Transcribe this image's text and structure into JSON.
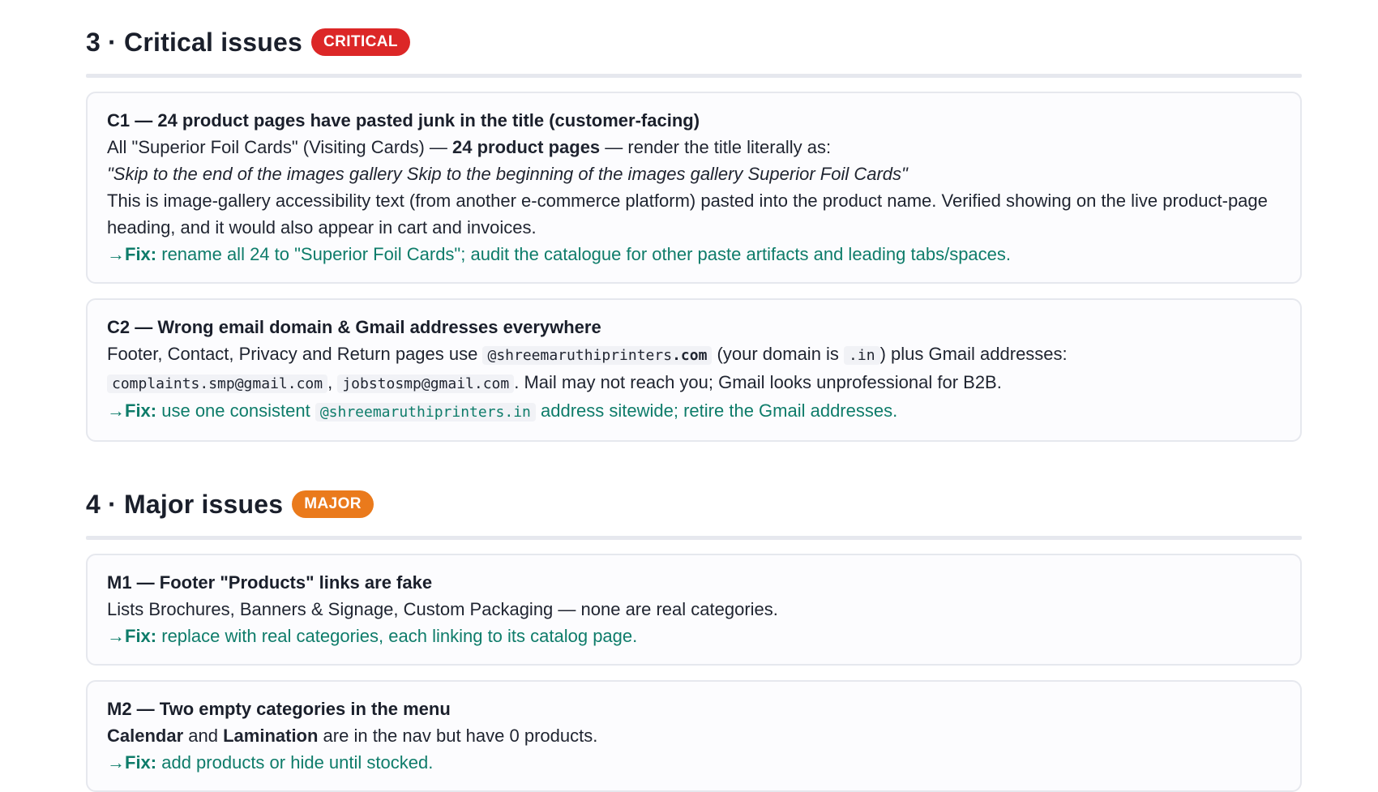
{
  "critical": {
    "heading": "3 · Critical issues",
    "badge": "CRITICAL",
    "c1": {
      "title": "C1 — 24 product pages have pasted junk in the title (customer-facing)",
      "p1_a": "All \"Superior Foil Cards\" (Visiting Cards) — ",
      "p1_b": "24 product pages",
      "p1_c": " — render the title literally as:",
      "quote": "\"Skip to the end of the images gallery Skip to the beginning of the images gallery Superior Foil Cards\"",
      "p2": "This is image-gallery accessibility text (from another e-commerce platform) pasted into the product name. Verified showing on the live product-page heading, and it would also appear in cart and invoices.",
      "fix_arrow": "→",
      "fix_label": "Fix:",
      "fix_text": " rename all 24 to \"Superior Foil Cards\"; audit the catalogue for other paste artifacts and leading tabs/spaces."
    },
    "c2": {
      "title": "C2 — Wrong email domain & Gmail addresses everywhere",
      "p1_a": "Footer, Contact, Privacy and Return pages use ",
      "code_domain_a": "@shreemaruthiprinters",
      "code_domain_b": ".com",
      "p1_b": " (your domain is ",
      "code_in": ".in",
      "p1_c": ") plus Gmail addresses:",
      "code_gmail1": "complaints.smp@gmail.com",
      "comma": ", ",
      "code_gmail2": "jobstosmp@gmail.com",
      "p1_d": ". Mail may not reach you; Gmail looks unprofessional for B2B.",
      "fix_arrow": "→",
      "fix_label": "Fix:",
      "fix_a": " use one consistent ",
      "fix_code": "@shreemaruthiprinters.in",
      "fix_b": " address sitewide; retire the Gmail addresses."
    }
  },
  "major": {
    "heading": "4 · Major issues",
    "badge": "MAJOR",
    "m1": {
      "title": "M1 — Footer \"Products\" links are fake",
      "p1": "Lists Brochures, Banners & Signage, Custom Packaging — none are real categories.",
      "fix_arrow": "→",
      "fix_label": "Fix:",
      "fix_text": " replace with real categories, each linking to its catalog page."
    },
    "m2": {
      "title": "M2 — Two empty categories in the menu",
      "b1": "Calendar",
      "t1": " and ",
      "b2": "Lamination",
      "t2": " are in the nav but have 0 products.",
      "fix_arrow": "→",
      "fix_label": "Fix:",
      "fix_text": " add products or hide until stocked."
    }
  }
}
